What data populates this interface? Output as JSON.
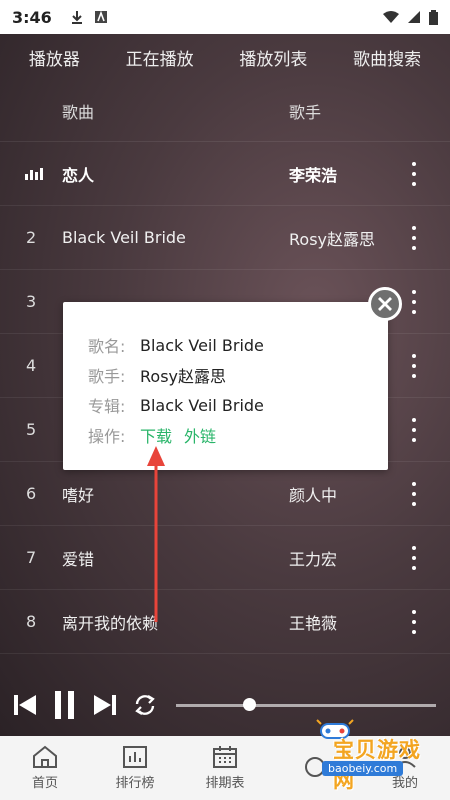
{
  "status": {
    "time": "3:46"
  },
  "tabs": [
    "播放器",
    "正在播放",
    "播放列表",
    "歌曲搜索"
  ],
  "list_header": {
    "song": "歌曲",
    "singer": "歌手"
  },
  "songs": [
    {
      "index": "",
      "title": "恋人",
      "artist": "李荣浩",
      "playing": true
    },
    {
      "index": "2",
      "title": "Black Veil Bride",
      "artist": "Rosy赵露思"
    },
    {
      "index": "3",
      "title": "",
      "artist": ""
    },
    {
      "index": "4",
      "title": "",
      "artist": ""
    },
    {
      "index": "5",
      "title": "",
      "artist": ""
    },
    {
      "index": "6",
      "title": "嗜好",
      "artist": "颜人中"
    },
    {
      "index": "7",
      "title": "爱错",
      "artist": "王力宏"
    },
    {
      "index": "8",
      "title": "离开我的依赖",
      "artist": "王艳薇"
    }
  ],
  "popup": {
    "name_label": "歌名:",
    "name": "Black Veil Bride",
    "singer_label": "歌手:",
    "singer": "Rosy赵露思",
    "album_label": "专辑:",
    "album": "Black Veil Bride",
    "action_label": "操作:",
    "download": "下载",
    "external_link": "外链"
  },
  "player": {
    "progress_fraction": 0.27
  },
  "bottom_nav": [
    "首页",
    "排行榜",
    "排期表",
    "",
    "我的"
  ],
  "watermark": {
    "text": "宝贝游戏网",
    "url": "baobeiy.com"
  },
  "colors": {
    "link_green": "#2ab56a",
    "watermark_orange": "#f3a521"
  }
}
